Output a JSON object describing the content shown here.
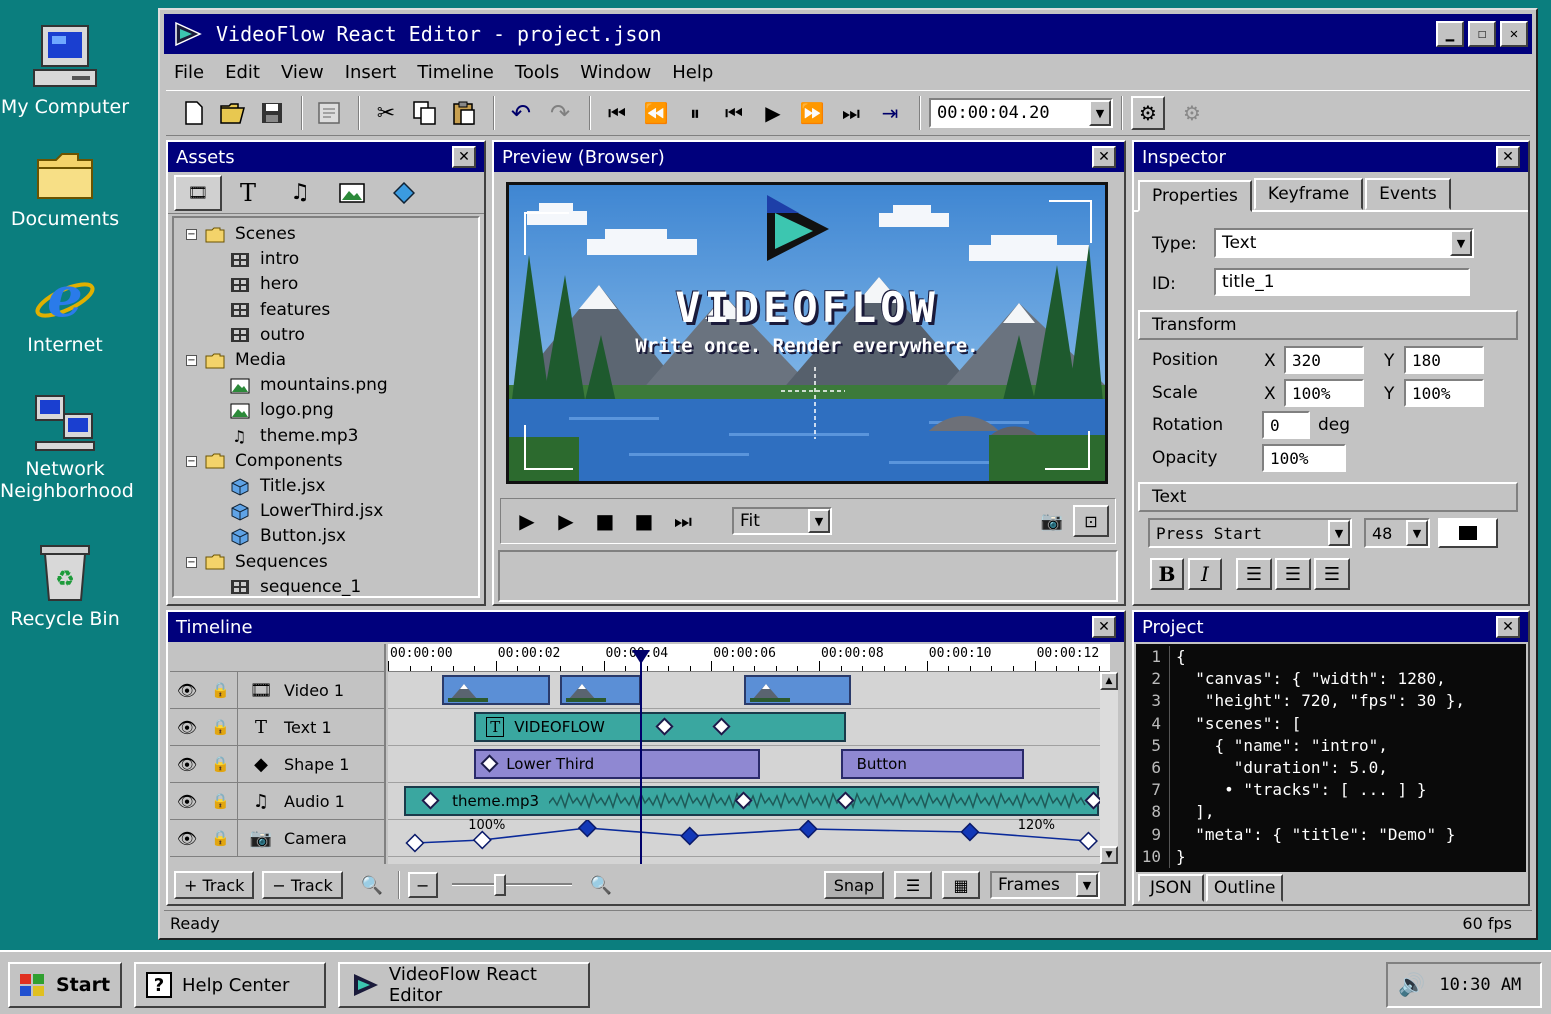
{
  "desktop": {
    "icons": [
      {
        "label": "My Computer"
      },
      {
        "label": "Documents"
      },
      {
        "label": "Internet"
      },
      {
        "label": "Network Neighborhood"
      },
      {
        "label": "Recycle Bin"
      }
    ]
  },
  "window": {
    "title": "VideoFlow React Editor - project.json",
    "menu": [
      "File",
      "Edit",
      "View",
      "Insert",
      "Timeline",
      "Tools",
      "Window",
      "Help"
    ],
    "timecode": "00:00:04.20"
  },
  "assets": {
    "title": "Assets",
    "tree": [
      {
        "label": "Scenes",
        "type": "folder",
        "level": 0
      },
      {
        "label": "intro",
        "type": "film",
        "level": 1
      },
      {
        "label": "hero",
        "type": "film",
        "level": 1
      },
      {
        "label": "features",
        "type": "film",
        "level": 1
      },
      {
        "label": "outro",
        "type": "film",
        "level": 1
      },
      {
        "label": "Media",
        "type": "folder",
        "level": 0
      },
      {
        "label": "mountains.png",
        "type": "image",
        "level": 1
      },
      {
        "label": "logo.png",
        "type": "image",
        "level": 1
      },
      {
        "label": "theme.mp3",
        "type": "music",
        "level": 1
      },
      {
        "label": "Components",
        "type": "folder",
        "level": 0
      },
      {
        "label": "Title.jsx",
        "type": "cube",
        "level": 1
      },
      {
        "label": "LowerThird.jsx",
        "type": "cube",
        "level": 1
      },
      {
        "label": "Button.jsx",
        "type": "cube",
        "level": 1
      },
      {
        "label": "Sequences",
        "type": "folder",
        "level": 0
      },
      {
        "label": "sequence_1",
        "type": "film",
        "level": 1
      }
    ]
  },
  "preview": {
    "title": "Preview (Browser)",
    "headline": "VIDEOFLOW",
    "tagline": "Write once. Render everywhere.",
    "zoom": "Fit"
  },
  "inspector": {
    "title": "Inspector",
    "tabs": [
      "Properties",
      "Keyframe",
      "Events"
    ],
    "type_label": "Type:",
    "type_value": "Text",
    "id_label": "ID:",
    "id_value": "title_1",
    "transform_header": "Transform",
    "position_label": "Position",
    "scale_label": "Scale",
    "rotation_label": "Rotation",
    "opacity_label": "Opacity",
    "x": "X",
    "y": "Y",
    "pos_x": "320",
    "pos_y": "180",
    "scale_x": "100%",
    "scale_y": "100%",
    "rotation": "0",
    "deg": "deg",
    "opacity": "100%",
    "text_header": "Text",
    "font": "Press Start",
    "font_size": "48",
    "color": "#000000"
  },
  "timeline": {
    "title": "Timeline",
    "ruler": [
      "00:00:00",
      "00:00:02",
      "00:00:04",
      "00:00:06",
      "00:00:08",
      "00:00:10",
      "00:00:12"
    ],
    "playhead_time": 4.7,
    "tracks": [
      {
        "name": "Video 1",
        "icon": "film-icon"
      },
      {
        "name": "Text 1",
        "icon": "text-icon"
      },
      {
        "name": "Shape 1",
        "icon": "shape-icon"
      },
      {
        "name": "Audio 1",
        "icon": "music-icon"
      },
      {
        "name": "Camera",
        "icon": "camera-icon"
      }
    ],
    "clips": {
      "text": "VIDEOFLOW",
      "lower_third": "Lower Third",
      "button": "Button",
      "audio": "theme.mp3"
    },
    "camera_labels": [
      "100%",
      "120%"
    ],
    "footer": {
      "add_track": "+ Track",
      "remove_track": "− Track",
      "snap": "Snap",
      "units": "Frames"
    }
  },
  "project": {
    "title": "Project",
    "code": [
      "{",
      "  \"canvas\": { \"width\": 1280,",
      "   \"height\": 720, \"fps\": 30 },",
      "  \"scenes\": [",
      "    { \"name\": \"intro\",",
      "      \"duration\": 5.0,",
      "     • \"tracks\": [ ... ] }",
      "  ],",
      "  \"meta\": { \"title\": \"Demo\" }",
      "}"
    ],
    "tabs": [
      "JSON",
      "Outline"
    ]
  },
  "status": {
    "left": "Ready",
    "right": "60 fps"
  },
  "taskbar": {
    "start": "Start",
    "items": [
      "Help Center",
      "VideoFlow React Editor"
    ],
    "clock": "10:30 AM"
  }
}
